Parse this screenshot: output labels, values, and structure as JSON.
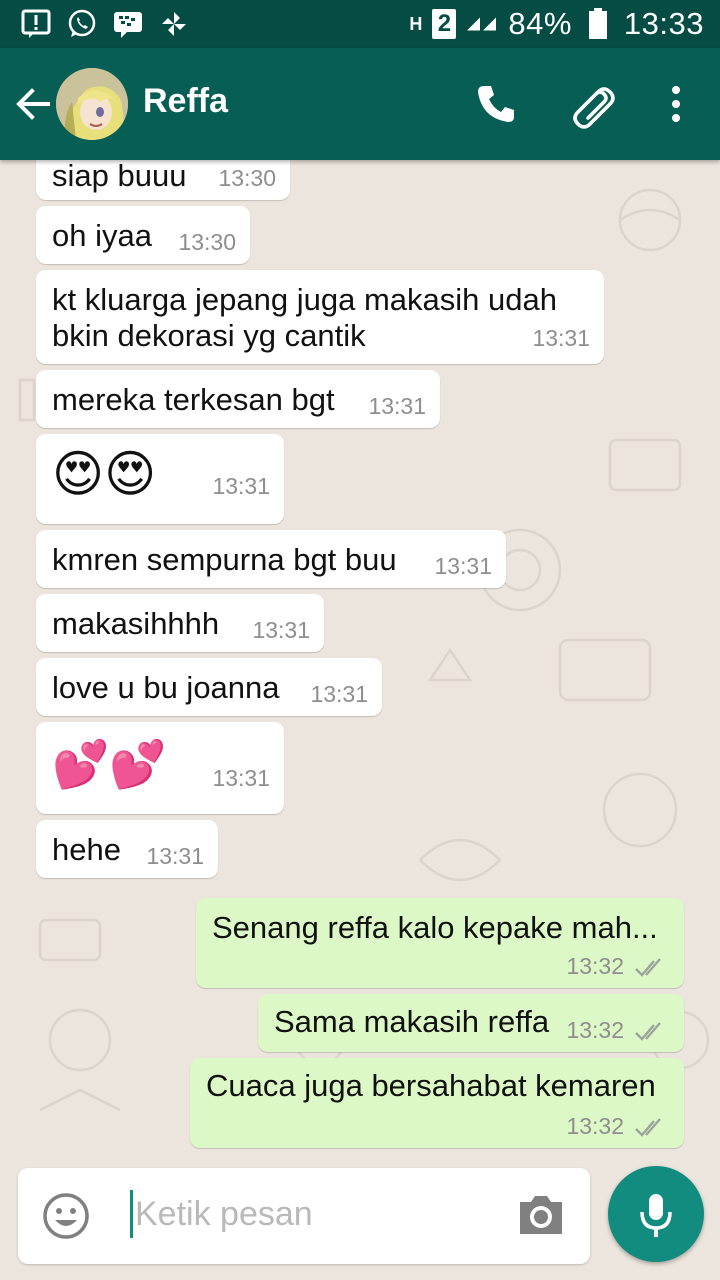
{
  "status_bar": {
    "battery_percent": "84%",
    "time": "13:33",
    "sim_slot": "2",
    "network": "H"
  },
  "header": {
    "contact_name": "Reffa"
  },
  "messages": [
    {
      "text": "siap buuu",
      "time": "13:30",
      "direction": "in"
    },
    {
      "text": "oh iyaa",
      "time": "13:30",
      "direction": "in"
    },
    {
      "text": "kt kluarga jepang juga makasih udah bkin dekorasi yg cantik",
      "time": "13:31",
      "direction": "in"
    },
    {
      "text": "mereka terkesan bgt",
      "time": "13:31",
      "direction": "in"
    },
    {
      "text": "😍😍",
      "time": "13:31",
      "direction": "in"
    },
    {
      "text": "kmren sempurna bgt buu",
      "time": "13:31",
      "direction": "in"
    },
    {
      "text": "makasihhhh",
      "time": "13:31",
      "direction": "in"
    },
    {
      "text": "love u bu joanna",
      "time": "13:31",
      "direction": "in"
    },
    {
      "text": "💕💕",
      "time": "13:31",
      "direction": "in"
    },
    {
      "text": "hehe",
      "time": "13:31",
      "direction": "in"
    },
    {
      "text": "Senang reffa kalo kepake mah...",
      "time": "13:32",
      "direction": "out"
    },
    {
      "text": "Sama makasih reffa",
      "time": "13:32",
      "direction": "out"
    },
    {
      "text": "Cuaca juga bersahabat kemaren",
      "time": "13:32",
      "direction": "out"
    }
  ],
  "composer": {
    "placeholder": "Ketik pesan"
  },
  "colors": {
    "app_bar": "#075e54",
    "status_bar": "#054d44",
    "chat_bg": "#ece5dd",
    "incoming_bubble": "#ffffff",
    "outgoing_bubble": "#dcf8c6",
    "accent": "#128c7e"
  },
  "icons": [
    "alert-icon",
    "whatsapp-icon",
    "bbm-icon",
    "pinwheel-icon",
    "signal-icon",
    "battery-icon",
    "back-arrow-icon",
    "call-icon",
    "attach-icon",
    "more-icon",
    "emoji-icon",
    "camera-icon",
    "mic-icon",
    "read-ticks-icon"
  ]
}
